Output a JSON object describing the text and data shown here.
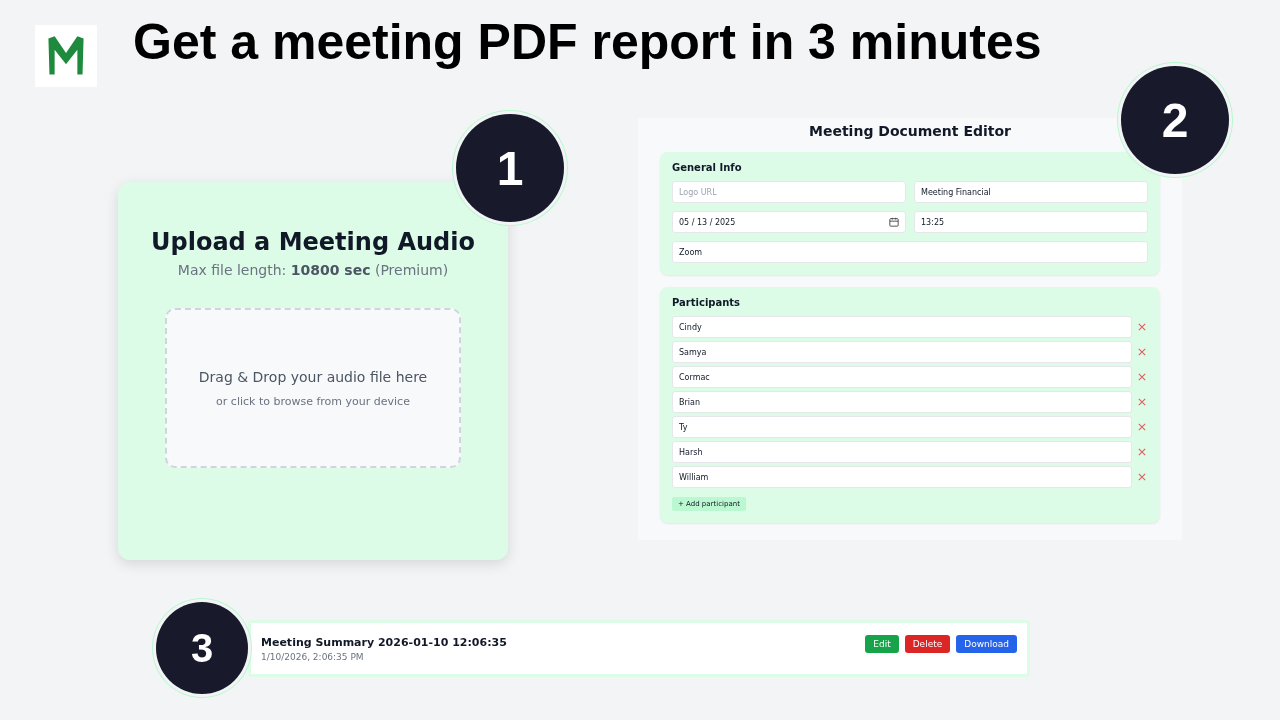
{
  "title": "Get a meeting PDF report in 3 minutes",
  "upload": {
    "step": "1",
    "title": "Upload a Meeting Audio",
    "limit": "Max file length: **10800 sec** (Premium)",
    "drop_title": "Drag & Drop your audio file here",
    "drop_hint": "or click to browse from your device"
  },
  "editor": {
    "step": "2",
    "title": "Meeting Document Editor",
    "general_info": {
      "heading": "General Info",
      "fields": [
        {
          "kind": "text",
          "placeholder": "Logo URL"
        },
        {
          "kind": "text",
          "value": "Meeting Financial"
        },
        {
          "kind": "date",
          "value": "05 / 13 / 2025"
        },
        {
          "kind": "text",
          "value": "13:25"
        },
        {
          "kind": "text",
          "value": "Zoom"
        }
      ]
    },
    "participants": {
      "heading": "Participants",
      "names": [
        "Cindy",
        "Samya",
        "Cormac",
        "Brian",
        "Ty",
        "Harsh",
        "William"
      ],
      "add_button": "+ Add participant"
    }
  },
  "history": {
    "step": "3",
    "title": "Meeting Summary 2026-01-10 12:06:35",
    "timestamp": "1/10/2026, 2:06:35 PM",
    "buttons": [
      {
        "label": "Edit",
        "color": "#16a34a"
      },
      {
        "label": "Delete",
        "color": "#dc2626"
      },
      {
        "label": "Download",
        "color": "#2563eb"
      }
    ]
  }
}
